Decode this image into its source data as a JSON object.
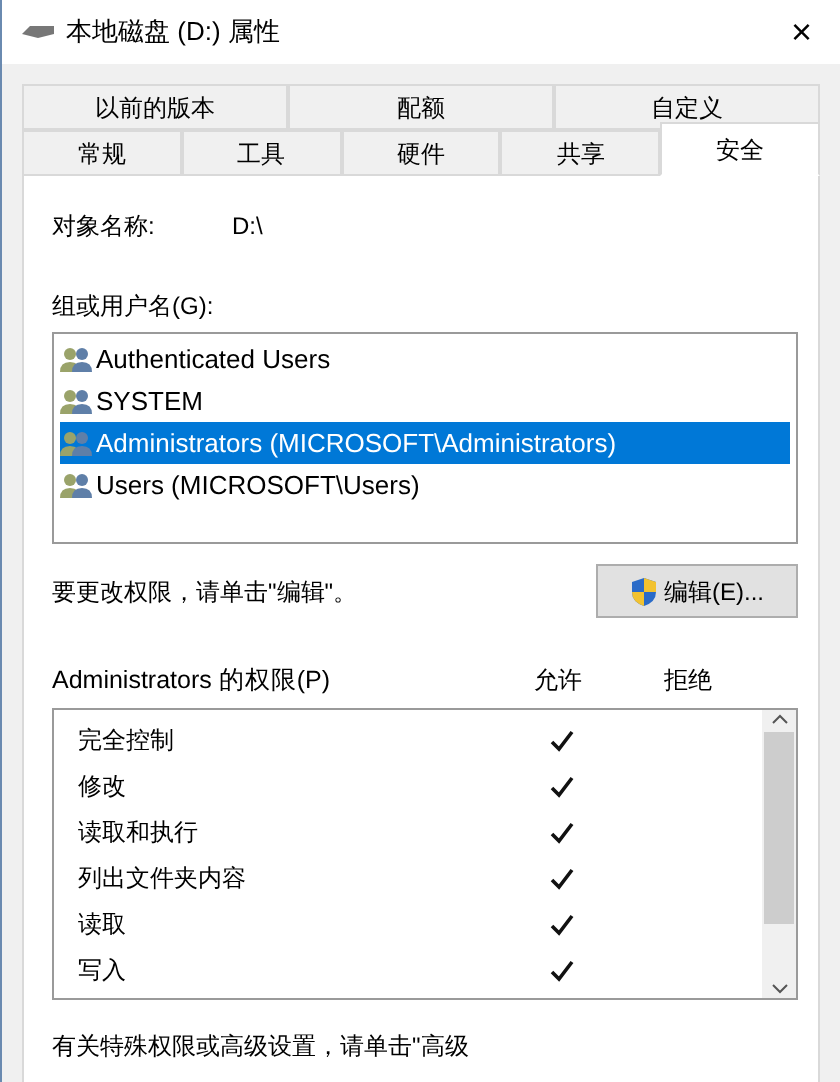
{
  "window": {
    "title": "本地磁盘 (D:) 属性",
    "close": "×"
  },
  "tabs_back": [
    {
      "label": "以前的版本",
      "selected": false
    },
    {
      "label": "配额",
      "selected": false
    },
    {
      "label": "自定义",
      "selected": false
    }
  ],
  "tabs_front": [
    {
      "label": "常规",
      "selected": false
    },
    {
      "label": "工具",
      "selected": false
    },
    {
      "label": "硬件",
      "selected": false
    },
    {
      "label": "共享",
      "selected": false
    },
    {
      "label": "安全",
      "selected": true
    }
  ],
  "object_name": {
    "label": "对象名称:",
    "value": "D:\\"
  },
  "groups": {
    "label": "组或用户名(G):",
    "items": [
      {
        "name": "Authenticated Users",
        "selected": false
      },
      {
        "name": "SYSTEM",
        "selected": false
      },
      {
        "name": "Administrators (MICROSOFT\\Administrators)",
        "selected": true
      },
      {
        "name": "Users (MICROSOFT\\Users)",
        "selected": false
      }
    ]
  },
  "edit_hint": "要更改权限，请单击\"编辑\"。",
  "edit_button": "编辑(E)...",
  "permissions": {
    "label": "Administrators 的权限(P)",
    "allow_header": "允许",
    "deny_header": "拒绝",
    "rows": [
      {
        "name": "完全控制",
        "allow": true
      },
      {
        "name": "修改",
        "allow": true
      },
      {
        "name": "读取和执行",
        "allow": true
      },
      {
        "name": "列出文件夹内容",
        "allow": true
      },
      {
        "name": "读取",
        "allow": true
      },
      {
        "name": "写入",
        "allow": true
      }
    ]
  },
  "advanced_hint": "有关特殊权限或高级设置，请单击\"高级"
}
